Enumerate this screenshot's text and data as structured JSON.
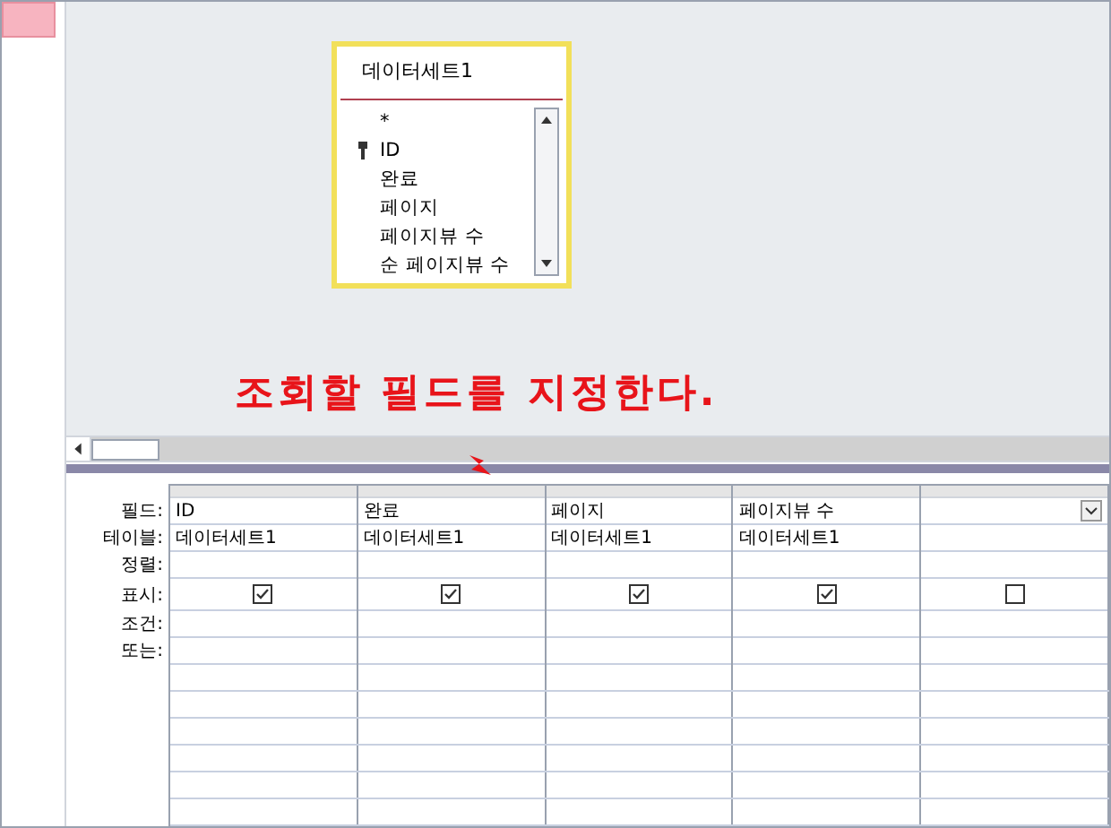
{
  "table_box": {
    "title": "데이터세트1",
    "fields": [
      {
        "name": "*",
        "key": false
      },
      {
        "name": "ID",
        "key": true
      },
      {
        "name": "완료",
        "key": false
      },
      {
        "name": "페이지",
        "key": false
      },
      {
        "name": "페이지뷰 수",
        "key": false
      },
      {
        "name": "순 페이지뷰 수",
        "key": false
      }
    ]
  },
  "annotation": "조회할 필드를 지정한다.",
  "grid": {
    "row_labels": [
      "필드:",
      "테이블:",
      "정렬:",
      "표시:",
      "조건:",
      "또는:"
    ],
    "columns": [
      {
        "field": "ID",
        "table": "데이터세트1",
        "show": true,
        "dropdown": false
      },
      {
        "field": "완료",
        "table": "데이터세트1",
        "show": true,
        "dropdown": false
      },
      {
        "field": "페이지",
        "table": "데이터세트1",
        "show": true,
        "dropdown": false
      },
      {
        "field": "페이지뷰 수",
        "table": "데이터세트1",
        "show": true,
        "dropdown": false
      },
      {
        "show": false,
        "dropdown": true
      }
    ]
  }
}
